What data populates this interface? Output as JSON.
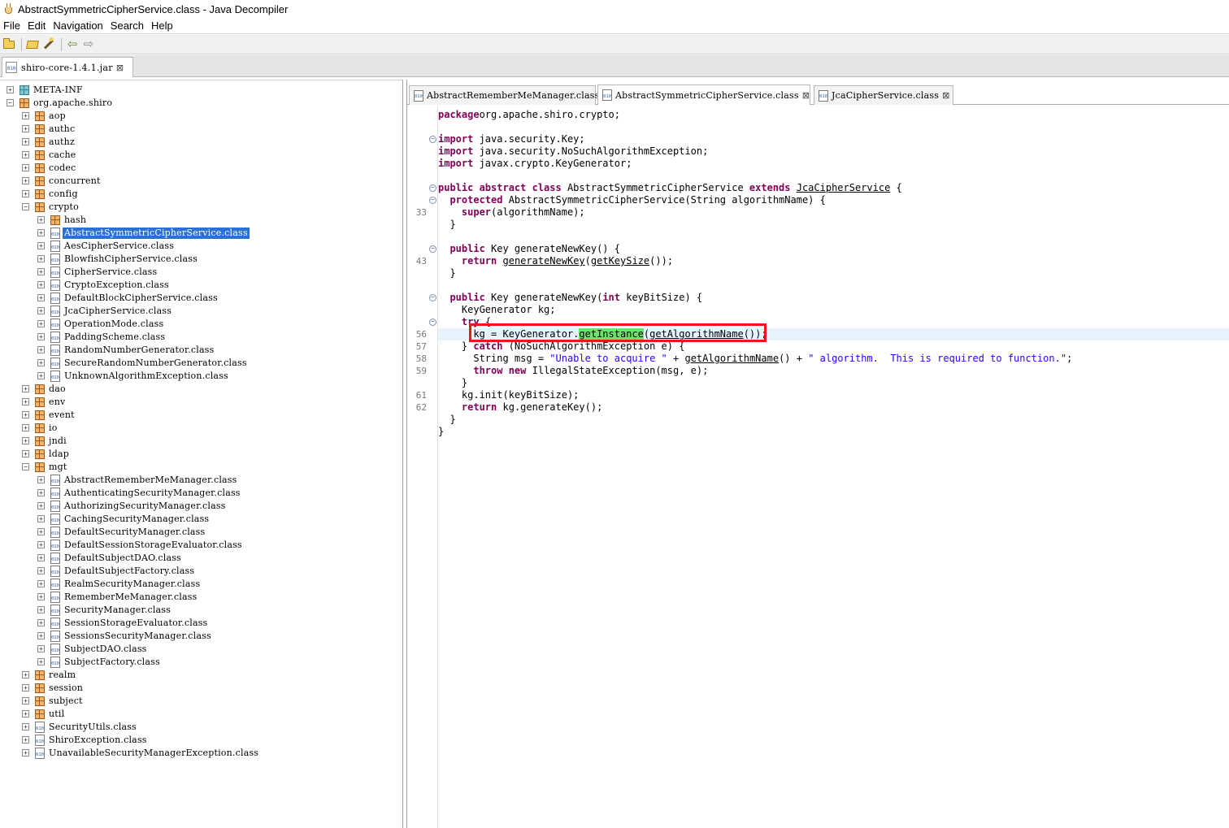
{
  "window": {
    "title": "AbstractSymmetricCipherService.class - Java Decompiler"
  },
  "menu": [
    "File",
    "Edit",
    "Navigation",
    "Search",
    "Help"
  ],
  "toolbar": {
    "icons": [
      "open-file-icon",
      "open-type-icon",
      "open-type-hierarchy-icon",
      "back-icon",
      "forward-icon"
    ]
  },
  "file_tab": {
    "label": "shiro-core-1.4.1.jar",
    "icon_text": "010"
  },
  "tree": [
    {
      "label": "META-INF",
      "level": 0,
      "kind": "meta",
      "state": "collapsed"
    },
    {
      "label": "org.apache.shiro",
      "level": 0,
      "kind": "package",
      "state": "expanded"
    },
    {
      "label": "aop",
      "level": 1,
      "kind": "package",
      "state": "collapsed"
    },
    {
      "label": "authc",
      "level": 1,
      "kind": "package",
      "state": "collapsed"
    },
    {
      "label": "authz",
      "level": 1,
      "kind": "package",
      "state": "collapsed"
    },
    {
      "label": "cache",
      "level": 1,
      "kind": "package",
      "state": "collapsed"
    },
    {
      "label": "codec",
      "level": 1,
      "kind": "package",
      "state": "collapsed"
    },
    {
      "label": "concurrent",
      "level": 1,
      "kind": "package",
      "state": "collapsed"
    },
    {
      "label": "config",
      "level": 1,
      "kind": "package",
      "state": "collapsed"
    },
    {
      "label": "crypto",
      "level": 1,
      "kind": "package",
      "state": "expanded"
    },
    {
      "label": "hash",
      "level": 2,
      "kind": "package",
      "state": "collapsed"
    },
    {
      "label": "AbstractSymmetricCipherService.class",
      "level": 2,
      "kind": "class",
      "state": "collapsed",
      "selected": true
    },
    {
      "label": "AesCipherService.class",
      "level": 2,
      "kind": "class",
      "state": "collapsed"
    },
    {
      "label": "BlowfishCipherService.class",
      "level": 2,
      "kind": "class",
      "state": "collapsed"
    },
    {
      "label": "CipherService.class",
      "level": 2,
      "kind": "class",
      "state": "collapsed"
    },
    {
      "label": "CryptoException.class",
      "level": 2,
      "kind": "class",
      "state": "collapsed"
    },
    {
      "label": "DefaultBlockCipherService.class",
      "level": 2,
      "kind": "class",
      "state": "collapsed"
    },
    {
      "label": "JcaCipherService.class",
      "level": 2,
      "kind": "class",
      "state": "collapsed"
    },
    {
      "label": "OperationMode.class",
      "level": 2,
      "kind": "class",
      "state": "collapsed"
    },
    {
      "label": "PaddingScheme.class",
      "level": 2,
      "kind": "class",
      "state": "collapsed"
    },
    {
      "label": "RandomNumberGenerator.class",
      "level": 2,
      "kind": "class",
      "state": "collapsed"
    },
    {
      "label": "SecureRandomNumberGenerator.class",
      "level": 2,
      "kind": "class",
      "state": "collapsed"
    },
    {
      "label": "UnknownAlgorithmException.class",
      "level": 2,
      "kind": "class",
      "state": "collapsed"
    },
    {
      "label": "dao",
      "level": 1,
      "kind": "package",
      "state": "collapsed"
    },
    {
      "label": "env",
      "level": 1,
      "kind": "package",
      "state": "collapsed"
    },
    {
      "label": "event",
      "level": 1,
      "kind": "package",
      "state": "collapsed"
    },
    {
      "label": "io",
      "level": 1,
      "kind": "package",
      "state": "collapsed"
    },
    {
      "label": "jndi",
      "level": 1,
      "kind": "package",
      "state": "collapsed"
    },
    {
      "label": "ldap",
      "level": 1,
      "kind": "package",
      "state": "collapsed"
    },
    {
      "label": "mgt",
      "level": 1,
      "kind": "package",
      "state": "expanded"
    },
    {
      "label": "AbstractRememberMeManager.class",
      "level": 2,
      "kind": "class",
      "state": "collapsed"
    },
    {
      "label": "AuthenticatingSecurityManager.class",
      "level": 2,
      "kind": "class",
      "state": "collapsed"
    },
    {
      "label": "AuthorizingSecurityManager.class",
      "level": 2,
      "kind": "class",
      "state": "collapsed"
    },
    {
      "label": "CachingSecurityManager.class",
      "level": 2,
      "kind": "class",
      "state": "collapsed"
    },
    {
      "label": "DefaultSecurityManager.class",
      "level": 2,
      "kind": "class",
      "state": "collapsed"
    },
    {
      "label": "DefaultSessionStorageEvaluator.class",
      "level": 2,
      "kind": "class",
      "state": "collapsed"
    },
    {
      "label": "DefaultSubjectDAO.class",
      "level": 2,
      "kind": "class",
      "state": "collapsed"
    },
    {
      "label": "DefaultSubjectFactory.class",
      "level": 2,
      "kind": "class",
      "state": "collapsed"
    },
    {
      "label": "RealmSecurityManager.class",
      "level": 2,
      "kind": "class",
      "state": "collapsed"
    },
    {
      "label": "RememberMeManager.class",
      "level": 2,
      "kind": "class",
      "state": "collapsed"
    },
    {
      "label": "SecurityManager.class",
      "level": 2,
      "kind": "class",
      "state": "collapsed"
    },
    {
      "label": "SessionStorageEvaluator.class",
      "level": 2,
      "kind": "class",
      "state": "collapsed"
    },
    {
      "label": "SessionsSecurityManager.class",
      "level": 2,
      "kind": "class",
      "state": "collapsed"
    },
    {
      "label": "SubjectDAO.class",
      "level": 2,
      "kind": "class",
      "state": "collapsed"
    },
    {
      "label": "SubjectFactory.class",
      "level": 2,
      "kind": "class",
      "state": "collapsed"
    },
    {
      "label": "realm",
      "level": 1,
      "kind": "package",
      "state": "collapsed"
    },
    {
      "label": "session",
      "level": 1,
      "kind": "package",
      "state": "collapsed"
    },
    {
      "label": "subject",
      "level": 1,
      "kind": "package",
      "state": "collapsed"
    },
    {
      "label": "util",
      "level": 1,
      "kind": "package",
      "state": "collapsed"
    },
    {
      "label": "SecurityUtils.class",
      "level": 1,
      "kind": "class",
      "state": "collapsed"
    },
    {
      "label": "ShiroException.class",
      "level": 1,
      "kind": "class",
      "state": "collapsed"
    },
    {
      "label": "UnavailableSecurityManagerException.class",
      "level": 1,
      "kind": "class",
      "state": "collapsed"
    }
  ],
  "editor_tabs": [
    {
      "label": "AbstractRememberMeManager.class",
      "active": false
    },
    {
      "label": "AbstractSymmetricCipherService.class",
      "active": true
    },
    {
      "label": "JcaCipherService.class",
      "active": false
    }
  ],
  "code": [
    {
      "row": 0,
      "num": "",
      "fold": "",
      "parts": [
        [
          "kw",
          "package"
        ],
        [
          "",
          "org.apache.shiro.crypto;"
        ]
      ]
    },
    {
      "row": 2,
      "num": "",
      "fold": "−",
      "parts": [
        [
          "kw",
          "import"
        ],
        [
          "",
          " java.security.Key;"
        ]
      ]
    },
    {
      "row": 3,
      "num": "",
      "fold": "",
      "parts": [
        [
          "kw",
          "import"
        ],
        [
          "",
          " java.security.NoSuchAlgorithmException;"
        ]
      ]
    },
    {
      "row": 4,
      "num": "",
      "fold": "",
      "parts": [
        [
          "kw",
          "import"
        ],
        [
          "",
          " javax.crypto.KeyGenerator;"
        ]
      ]
    },
    {
      "row": 6,
      "num": "",
      "fold": "−",
      "parts": [
        [
          "kw",
          "public abstract class"
        ],
        [
          "",
          " AbstractSymmetricCipherService "
        ],
        [
          "kw",
          "extends"
        ],
        [
          "",
          " "
        ],
        [
          "ul",
          "JcaCipherService"
        ],
        [
          "",
          " {"
        ]
      ]
    },
    {
      "row": 7,
      "num": "",
      "fold": "−",
      "parts": [
        [
          "",
          "  "
        ],
        [
          "kw",
          "protected"
        ],
        [
          "",
          " AbstractSymmetricCipherService(String algorithmName) {"
        ]
      ]
    },
    {
      "row": 8,
      "num": "33",
      "fold": "",
      "parts": [
        [
          "",
          "    "
        ],
        [
          "kw",
          "super"
        ],
        [
          "",
          "(algorithmName);"
        ]
      ]
    },
    {
      "row": 9,
      "num": "",
      "fold": "",
      "parts": [
        [
          "",
          "  }"
        ]
      ]
    },
    {
      "row": 11,
      "num": "",
      "fold": "−",
      "parts": [
        [
          "",
          "  "
        ],
        [
          "kw",
          "public"
        ],
        [
          "",
          " Key generateNewKey() {"
        ]
      ]
    },
    {
      "row": 12,
      "num": "43",
      "fold": "",
      "parts": [
        [
          "",
          "    "
        ],
        [
          "kw",
          "return"
        ],
        [
          "",
          " "
        ],
        [
          "ul",
          "generateNewKey"
        ],
        [
          "",
          "("
        ],
        [
          "ul",
          "getKeySize"
        ],
        [
          "",
          "());"
        ]
      ]
    },
    {
      "row": 13,
      "num": "",
      "fold": "",
      "parts": [
        [
          "",
          "  }"
        ]
      ]
    },
    {
      "row": 15,
      "num": "",
      "fold": "−",
      "parts": [
        [
          "",
          "  "
        ],
        [
          "kw",
          "public"
        ],
        [
          "",
          " Key generateNewKey("
        ],
        [
          "kw",
          "int"
        ],
        [
          "",
          " keyBitSize) {"
        ]
      ]
    },
    {
      "row": 16,
      "num": "",
      "fold": "",
      "parts": [
        [
          "",
          "    KeyGenerator kg;"
        ]
      ]
    },
    {
      "row": 17,
      "num": "",
      "fold": "−",
      "parts": [
        [
          "",
          "    "
        ],
        [
          "kw",
          "try"
        ],
        [
          "",
          " {"
        ]
      ]
    },
    {
      "row": 18,
      "num": "56",
      "fold": "",
      "current": true,
      "parts": [
        [
          "",
          "      kg = KeyGenerator."
        ],
        [
          "hl",
          "getInstance"
        ],
        [
          "",
          "("
        ],
        [
          "ul",
          "getAlgorithmName"
        ],
        [
          "",
          "());"
        ]
      ]
    },
    {
      "row": 19,
      "num": "57",
      "fold": "",
      "parts": [
        [
          "",
          "    } "
        ],
        [
          "kw",
          "catch"
        ],
        [
          "",
          " (NoSuchAlgorithmException e) {"
        ]
      ]
    },
    {
      "row": 20,
      "num": "58",
      "fold": "",
      "parts": [
        [
          "",
          "      String msg = "
        ],
        [
          "str",
          "\"Unable to acquire \""
        ],
        [
          "",
          " + "
        ],
        [
          "ul",
          "getAlgorithmName"
        ],
        [
          "",
          "() + "
        ],
        [
          "str",
          "\" algorithm.  This is required to function.\""
        ],
        [
          "",
          ";"
        ]
      ]
    },
    {
      "row": 21,
      "num": "59",
      "fold": "",
      "parts": [
        [
          "",
          "      "
        ],
        [
          "kw",
          "throw new"
        ],
        [
          "",
          " IllegalStateException(msg, e);"
        ]
      ]
    },
    {
      "row": 22,
      "num": "",
      "fold": "",
      "parts": [
        [
          "",
          "    }"
        ]
      ]
    },
    {
      "row": 23,
      "num": "61",
      "fold": "",
      "parts": [
        [
          "",
          "    kg.init(keyBitSize);"
        ]
      ]
    },
    {
      "row": 24,
      "num": "62",
      "fold": "",
      "parts": [
        [
          "",
          "    "
        ],
        [
          "kw",
          "return"
        ],
        [
          "",
          " kg.generateKey();"
        ]
      ]
    },
    {
      "row": 25,
      "num": "",
      "fold": "",
      "parts": [
        [
          "",
          "  }"
        ]
      ]
    },
    {
      "row": 26,
      "num": "",
      "fold": "",
      "parts": [
        [
          "",
          "}"
        ]
      ]
    }
  ],
  "colors": {
    "keyword": "#7f0055",
    "string": "#2a00ff",
    "selection": "#2a70d6",
    "highlight": "#6be36b",
    "annotation_box": "#f01616"
  }
}
